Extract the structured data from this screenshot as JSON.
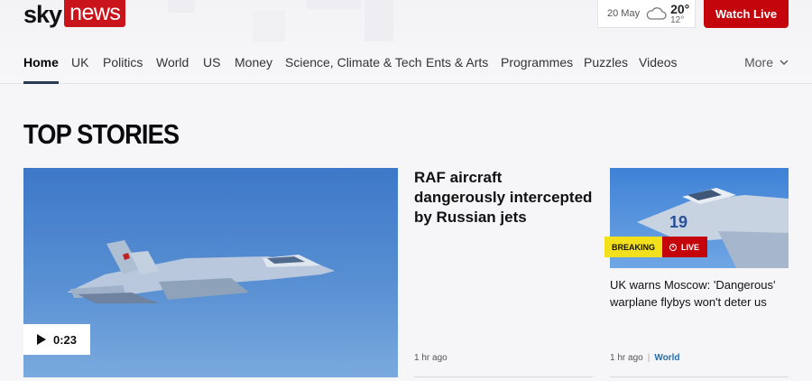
{
  "header": {
    "logo_sky": "sky",
    "logo_news": "news",
    "weather": {
      "date": "20 May",
      "high": "20°",
      "low": "12°",
      "icon": "cloud-icon"
    },
    "watch_live_label": "Watch Live"
  },
  "nav": {
    "items": [
      "Home",
      "UK",
      "Politics",
      "World",
      "US",
      "Money",
      "Science, Climate & Tech",
      "Ents & Arts",
      "Programmes",
      "Puzzles",
      "Videos"
    ],
    "active": "Home",
    "more_label": "More"
  },
  "section_title": "TOP STORIES",
  "hero": {
    "video_duration": "0:23",
    "headline": "RAF aircraft dangerously intercepted by Russian jets",
    "time": "1 hr ago"
  },
  "side_story": {
    "breaking_label": "BREAKING",
    "live_label": "LIVE",
    "headline": "UK warns Moscow: 'Dangerous' warplane flybys won't deter us",
    "time": "1 hr ago",
    "tag": "World"
  },
  "colors": {
    "brand_red": "#c5050c",
    "breaking_yellow": "#f3e01c",
    "tag_blue": "#1f6fb3",
    "active_underline": "#2a3a55"
  }
}
